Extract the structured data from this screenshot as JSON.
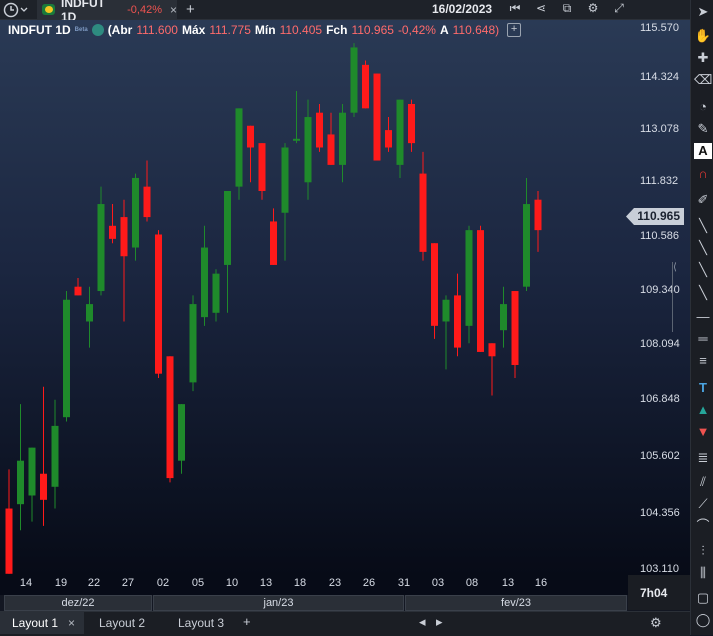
{
  "topbar": {
    "tab_title": "INDFUT 1D",
    "tab_change": "-0,42%",
    "tab_close": "×",
    "add_tab": "+",
    "date": "16/02/2023"
  },
  "legend": {
    "symbol": "INDFUT 1D",
    "badge": "Beta",
    "open_label": "(Abr",
    "open": "111.600",
    "high_label": "Máx",
    "high": "111.775",
    "low_label": "Mín",
    "low": "110.405",
    "close_label": "Fch",
    "close": "110.965",
    "change": "-0,42%",
    "avg_label": "A",
    "avg": "110.648)",
    "add": "+"
  },
  "price_axis": [
    "115.570",
    "114.324",
    "113.078",
    "111.832",
    "110.586",
    "109.340",
    "108.094",
    "106.848",
    "105.602",
    "104.356",
    "103.110"
  ],
  "last_price": "110.965",
  "time_axis": {
    "labels": [
      "14",
      "19",
      "22",
      "27",
      "02",
      "05",
      "10",
      "13",
      "18",
      "23",
      "26",
      "31",
      "03",
      "08",
      "13",
      "16"
    ],
    "months": [
      "dez/22",
      "jan/23",
      "fev/23"
    ],
    "countdown": "7h04"
  },
  "layouts": {
    "tab1": "Layout 1",
    "tab2": "Layout 2",
    "tab3": "Layout 3",
    "close": "×",
    "add": "+"
  },
  "colors": {
    "up": "#1f8a2b",
    "down": "#ff1a1a",
    "accent": "#ff6b6b"
  },
  "chart_data": {
    "type": "candlestick",
    "ylim": [
      103.11,
      115.57
    ],
    "candles": [
      {
        "x": "12/12",
        "o": 104.5,
        "h": 105.4,
        "l": 103.0,
        "c": 103.0
      },
      {
        "x": "13/12",
        "o": 104.6,
        "h": 106.9,
        "l": 104.0,
        "c": 105.6
      },
      {
        "x": "14/12",
        "o": 104.8,
        "h": 105.8,
        "l": 104.2,
        "c": 105.9
      },
      {
        "x": "15/12",
        "o": 105.3,
        "h": 107.3,
        "l": 104.1,
        "c": 104.7
      },
      {
        "x": "16/12",
        "o": 105.0,
        "h": 107.0,
        "l": 104.5,
        "c": 106.4
      },
      {
        "x": "19/12",
        "o": 106.6,
        "h": 109.5,
        "l": 106.5,
        "c": 109.3
      },
      {
        "x": "20/12",
        "o": 109.6,
        "h": 109.8,
        "l": 109.5,
        "c": 109.4
      },
      {
        "x": "21/12",
        "o": 108.8,
        "h": 109.6,
        "l": 108.2,
        "c": 109.2
      },
      {
        "x": "22/12",
        "o": 109.5,
        "h": 111.9,
        "l": 109.4,
        "c": 111.5
      },
      {
        "x": "23/12",
        "o": 111.0,
        "h": 111.5,
        "l": 110.6,
        "c": 110.7
      },
      {
        "x": "26/12",
        "o": 111.2,
        "h": 111.6,
        "l": 108.8,
        "c": 110.3
      },
      {
        "x": "27/12",
        "o": 110.5,
        "h": 112.2,
        "l": 110.2,
        "c": 112.1
      },
      {
        "x": "28/12",
        "o": 111.9,
        "h": 112.5,
        "l": 111.1,
        "c": 111.2
      },
      {
        "x": "02/01",
        "o": 110.8,
        "h": 110.9,
        "l": 107.5,
        "c": 107.6
      },
      {
        "x": "03/01",
        "o": 108.0,
        "h": 108.0,
        "l": 105.1,
        "c": 105.2
      },
      {
        "x": "04/01",
        "o": 105.6,
        "h": 106.6,
        "l": 105.3,
        "c": 106.9
      },
      {
        "x": "05/01",
        "o": 107.4,
        "h": 109.4,
        "l": 107.2,
        "c": 109.2
      },
      {
        "x": "06/01",
        "o": 108.9,
        "h": 111.0,
        "l": 108.7,
        "c": 110.5
      },
      {
        "x": "09/01",
        "o": 109.0,
        "h": 110.0,
        "l": 108.8,
        "c": 109.9
      },
      {
        "x": "10/01",
        "o": 110.1,
        "h": 111.2,
        "l": 109.0,
        "c": 111.8
      },
      {
        "x": "11/01",
        "o": 111.9,
        "h": 113.7,
        "l": 111.6,
        "c": 113.7
      },
      {
        "x": "12/01",
        "o": 113.3,
        "h": 113.2,
        "l": 112.0,
        "c": 112.8
      },
      {
        "x": "13/01",
        "o": 112.9,
        "h": 112.6,
        "l": 111.6,
        "c": 111.8
      },
      {
        "x": "16/01",
        "o": 111.1,
        "h": 111.4,
        "l": 110.2,
        "c": 110.1
      },
      {
        "x": "17/01",
        "o": 111.3,
        "h": 112.9,
        "l": 110.2,
        "c": 112.8
      },
      {
        "x": "18/01",
        "o": 113.0,
        "h": 114.1,
        "l": 112.9,
        "c": 113.0
      },
      {
        "x": "19/01",
        "o": 112.0,
        "h": 113.9,
        "l": 111.6,
        "c": 113.5
      },
      {
        "x": "20/01",
        "o": 113.6,
        "h": 113.8,
        "l": 112.7,
        "c": 112.8
      },
      {
        "x": "23/01",
        "o": 113.1,
        "h": 113.6,
        "l": 112.4,
        "c": 112.4
      },
      {
        "x": "24/01",
        "o": 112.4,
        "h": 113.8,
        "l": 112.0,
        "c": 113.6
      },
      {
        "x": "25/01",
        "o": 113.6,
        "h": 115.2,
        "l": 113.5,
        "c": 115.1
      },
      {
        "x": "26/01",
        "o": 114.7,
        "h": 114.8,
        "l": 113.7,
        "c": 113.7
      },
      {
        "x": "27/01",
        "o": 114.5,
        "h": 114.5,
        "l": 112.5,
        "c": 112.5
      },
      {
        "x": "30/01",
        "o": 113.2,
        "h": 113.5,
        "l": 112.7,
        "c": 112.8
      },
      {
        "x": "31/01",
        "o": 112.4,
        "h": 113.9,
        "l": 112.1,
        "c": 113.9
      },
      {
        "x": "01/02",
        "o": 113.8,
        "h": 113.9,
        "l": 112.7,
        "c": 112.9
      },
      {
        "x": "02/02",
        "o": 112.2,
        "h": 112.7,
        "l": 110.2,
        "c": 110.4
      },
      {
        "x": "03/02",
        "o": 110.6,
        "h": 110.6,
        "l": 108.4,
        "c": 108.7
      },
      {
        "x": "06/02",
        "o": 108.8,
        "h": 109.4,
        "l": 107.7,
        "c": 109.3
      },
      {
        "x": "07/02",
        "o": 109.4,
        "h": 109.9,
        "l": 108.0,
        "c": 108.2
      },
      {
        "x": "08/02",
        "o": 108.7,
        "h": 111.0,
        "l": 108.3,
        "c": 110.9
      },
      {
        "x": "09/02",
        "o": 110.9,
        "h": 111.0,
        "l": 108.1,
        "c": 108.1
      },
      {
        "x": "10/02",
        "o": 108.3,
        "h": 108.3,
        "l": 107.1,
        "c": 108.0
      },
      {
        "x": "13/02",
        "o": 108.6,
        "h": 109.6,
        "l": 108.2,
        "c": 109.2
      },
      {
        "x": "14/02",
        "o": 109.5,
        "h": 109.4,
        "l": 107.5,
        "c": 107.8
      },
      {
        "x": "15/02",
        "o": 109.6,
        "h": 112.1,
        "l": 109.5,
        "c": 111.5
      },
      {
        "x": "16/02",
        "o": 111.6,
        "h": 111.8,
        "l": 110.4,
        "c": 110.9
      }
    ]
  }
}
